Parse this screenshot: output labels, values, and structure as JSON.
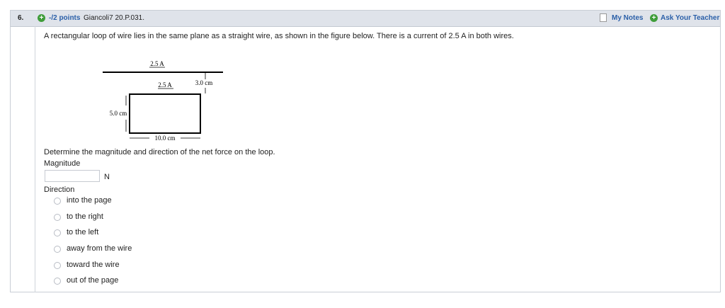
{
  "header": {
    "number": "6.",
    "points": "-/2 points",
    "question_id": "Giancoli7 20.P.031.",
    "my_notes": "My Notes",
    "ask_teacher": "Ask Your Teacher"
  },
  "question": {
    "prompt": "A rectangular loop of wire lies in the same plane as a straight wire, as shown in the figure below. There is a current of 2.5 A in both wires.",
    "ask": "Determine the magnitude and direction of the net force on the loop.",
    "magnitude_label": "Magnitude",
    "magnitude_value": "",
    "magnitude_unit": "N",
    "direction_label": "Direction",
    "options": [
      "into the page",
      "to the right",
      "to the left",
      "away from the wire",
      "toward the wire",
      "out of the page"
    ]
  },
  "figure": {
    "wire_current": "2.5 A",
    "loop_current": "2.5 A",
    "gap_label": "3.0 cm",
    "height_label": "5.0 cm",
    "width_label": "10.0 cm"
  },
  "colors": {
    "header_bg": "#dfe3ea",
    "link": "#2a5fa8",
    "plus": "#3f9d3a"
  }
}
